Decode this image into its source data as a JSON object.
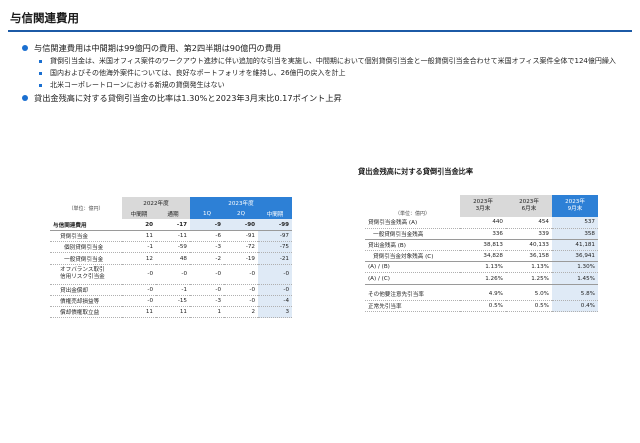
{
  "slide": {
    "title": "与信関連費用"
  },
  "bullets": {
    "b1": "与信関連費用は中間期は99億円の費用、第2四半期は90億円の費用",
    "b1_sub1": "貸倒引当金は、米国オフィス案件のワークアウト進捗に伴い追加的な引当を実施し、中間期において個別貸倒引当金と一般貸倒引当金合わせて米国オフィス案件全体で124億円繰入",
    "b1_sub2": "国内およびその他海外案件については、良好なポートフォリオを維持し、26億円の戻入を計上",
    "b1_sub3": "北米コーポレートローンにおける新規の貸倒発生はない",
    "b2": "貸出金残高に対する貸倒引当金の比率は1.30%と2023年3月末比0.17ポイント上昇"
  },
  "left_table": {
    "unit": "（単位：億円）",
    "group1": "2022年度",
    "group2": "2023年度",
    "cols": [
      "中間期",
      "通期",
      "1Q",
      "2Q",
      "中間期"
    ],
    "rows": [
      {
        "label": "与信関連費用",
        "v": [
          "20",
          "-17",
          "-9",
          "-90",
          "-99"
        ]
      },
      {
        "label": "貸倒引当金",
        "v": [
          "11",
          "-11",
          "-6",
          "-91",
          "-97"
        ]
      },
      {
        "label": "個別貸倒引当金",
        "v": [
          "-1",
          "-59",
          "-3",
          "-72",
          "-75"
        ]
      },
      {
        "label": "一般貸倒引当金",
        "v": [
          "12",
          "48",
          "-2",
          "-19",
          "-21"
        ]
      },
      {
        "label": "オフバランス取引信用リスク引当金",
        "label1": "オフバランス取引",
        "label2": "信用リスク引当金",
        "v": [
          "-0",
          "-0",
          "-0",
          "-0",
          "-0"
        ]
      },
      {
        "label": "貸出金償却",
        "v": [
          "-0",
          "-1",
          "-0",
          "-0",
          "-0"
        ]
      },
      {
        "label": "債権売却損益等",
        "v": [
          "-0",
          "-15",
          "-3",
          "-0",
          "-4"
        ]
      },
      {
        "label": "償却債権取立益",
        "v": [
          "11",
          "11",
          "1",
          "2",
          "3"
        ]
      }
    ]
  },
  "right_section": {
    "title": "貸出金残高に対する貸倒引当金比率",
    "unit": "（単位：億円）",
    "cols": [
      "2023年3月末",
      "2023年6月末",
      "2023年9月末"
    ],
    "col_lines": [
      [
        "2023年",
        "3月末"
      ],
      [
        "2023年",
        "6月末"
      ],
      [
        "2023年",
        "9月末"
      ]
    ],
    "rows": [
      {
        "label": "貸倒引当金残高 (A)",
        "v": [
          "440",
          "454",
          "537"
        ]
      },
      {
        "label": "一般貸倒引当金残高",
        "v": [
          "336",
          "339",
          "358"
        ]
      },
      {
        "label": "貸出金残高 (B)",
        "v": [
          "38,813",
          "40,133",
          "41,181"
        ]
      },
      {
        "label": "貸倒引当金対象残高 (C)",
        "v": [
          "34,828",
          "36,158",
          "36,941"
        ]
      },
      {
        "label": "(A) / (B)",
        "v": [
          "1.13%",
          "1.13%",
          "1.30%"
        ]
      },
      {
        "label": "(A) / (C)",
        "v": [
          "1.26%",
          "1.25%",
          "1.45%"
        ]
      },
      {
        "label": "その他要注意先引当率",
        "v": [
          "4.9%",
          "5.0%",
          "5.8%"
        ]
      },
      {
        "label": "正常先引当率",
        "v": [
          "0.5%",
          "0.5%",
          "0.4%"
        ]
      }
    ]
  },
  "colors": {
    "accent": "#1c5aa6",
    "highlight": "#2d80d6",
    "highlight_bg": "#dfeaf6",
    "grey_header": "#d9d9d9"
  }
}
